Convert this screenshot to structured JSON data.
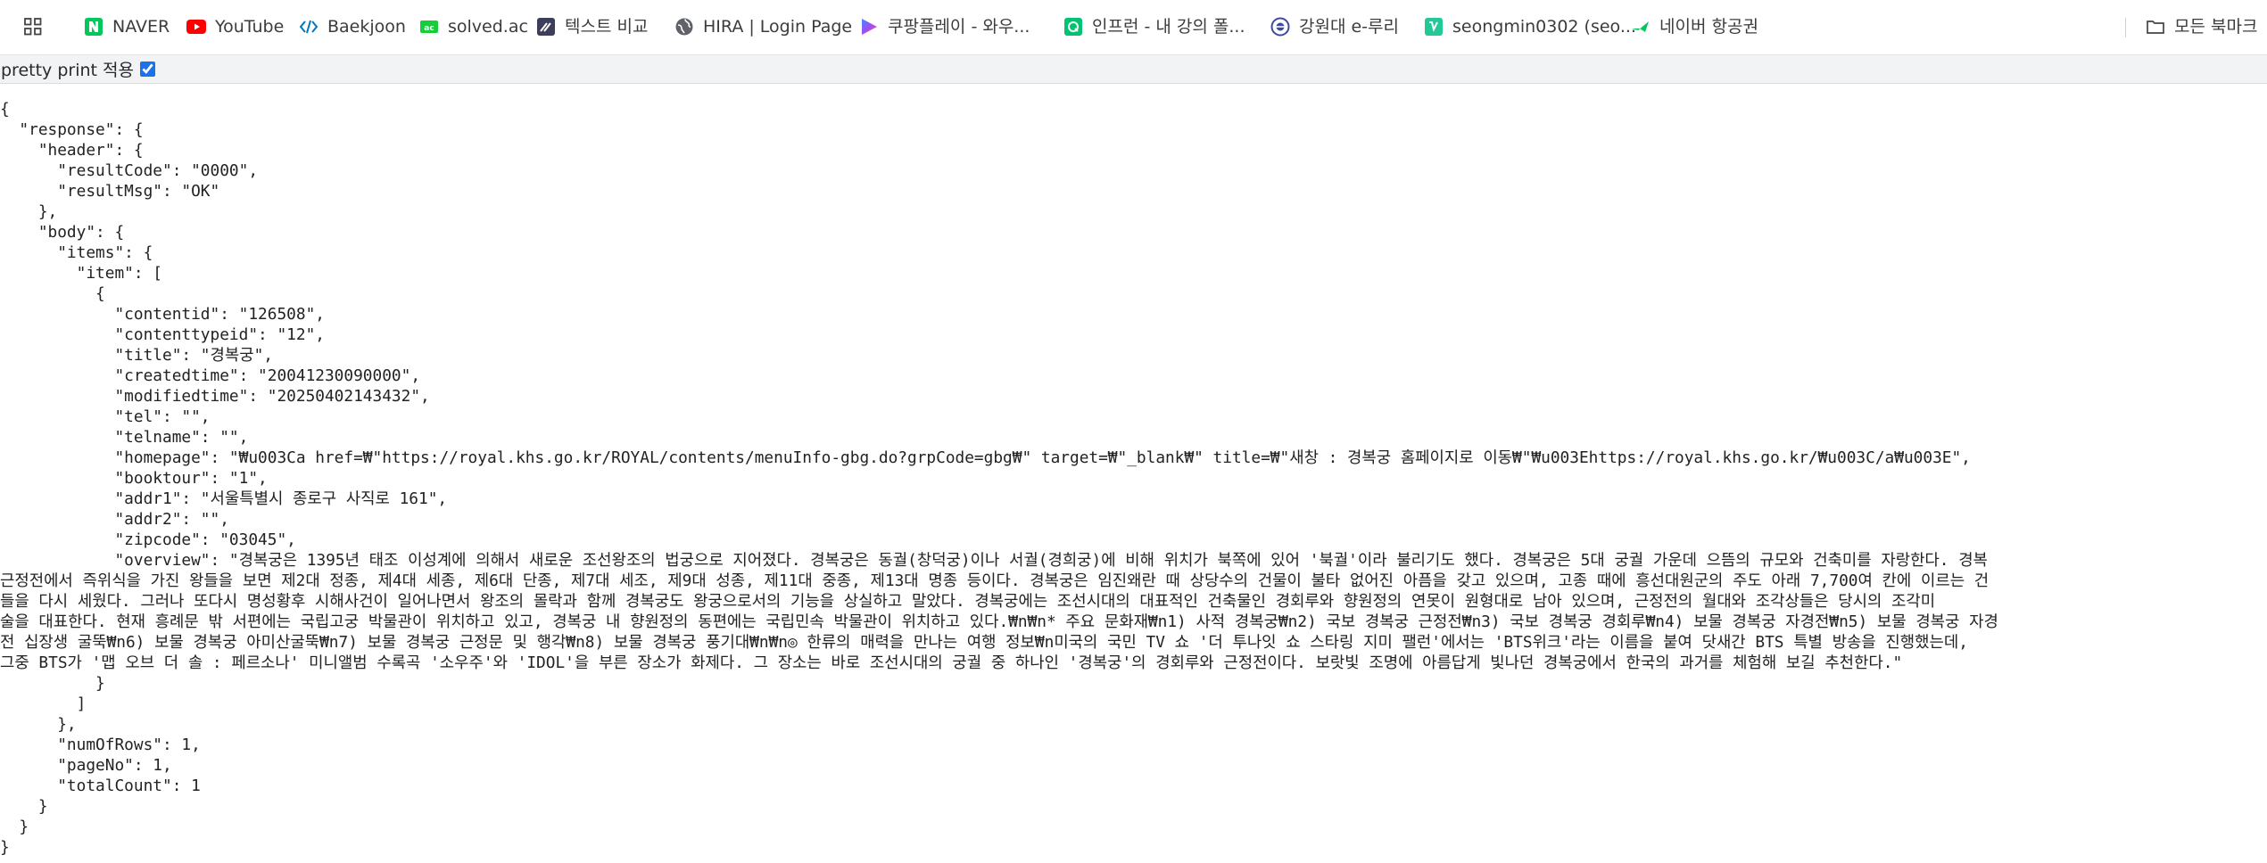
{
  "bookmarks": [
    {
      "label": "",
      "icon": "apps-grid-icon"
    },
    {
      "label": "NAVER",
      "icon": "naver-icon",
      "color": "#03c75a"
    },
    {
      "label": "YouTube",
      "icon": "youtube-icon",
      "color": "#ff0000"
    },
    {
      "label": "Baekjoon",
      "icon": "baekjoon-icon",
      "color": "#0076c0"
    },
    {
      "label": "solved.ac",
      "icon": "solvedac-icon",
      "color": "#17ce3a"
    },
    {
      "label": "텍스트 비교",
      "icon": "text-compare-icon",
      "color": "#3d3d5c"
    },
    {
      "label": "HIRA | Login Page",
      "icon": "globe-icon",
      "color": "#5f6368"
    },
    {
      "label": "쿠팡플레이 - 와우...",
      "icon": "play-icon",
      "color": "#7b5cf5"
    },
    {
      "label": "인프런 - 내 강의 폴...",
      "icon": "inflearn-icon",
      "color": "#00c471"
    },
    {
      "label": "강원대 e-루리",
      "icon": "kangwon-icon",
      "color": "#3b4ba5"
    },
    {
      "label": "seongmin0302 (seo...",
      "icon": "velog-icon",
      "color": "#20c997"
    },
    {
      "label": "네이버 항공권",
      "icon": "flight-icon",
      "color": "#03c75a"
    },
    {
      "label": "모든 북마크",
      "icon": "folder-icon",
      "color": "#5f6368"
    }
  ],
  "pretty_print": {
    "label": "pretty print 적용",
    "checked": true
  },
  "json_lines": [
    "{",
    "  \"response\": {",
    "    \"header\": {",
    "      \"resultCode\": \"0000\",",
    "      \"resultMsg\": \"OK\"",
    "    },",
    "    \"body\": {",
    "      \"items\": {",
    "        \"item\": [",
    "          {",
    "            \"contentid\": \"126508\",",
    "            \"contenttypeid\": \"12\",",
    "            \"title\": \"경복궁\",",
    "            \"createdtime\": \"20041230090000\",",
    "            \"modifiedtime\": \"20250402143432\",",
    "            \"tel\": \"\",",
    "            \"telname\": \"\",",
    "            \"homepage\": \"₩u003Ca href=₩\"https://royal.khs.go.kr/ROYAL/contents/menuInfo-gbg.do?grpCode=gbg₩\" target=₩\"_blank₩\" title=₩\"새창 : 경복궁 홈페이지로 이동₩\"₩u003Ehttps://royal.khs.go.kr/₩u003C/a₩u003E\",",
    "            \"booktour\": \"1\",",
    "            \"addr1\": \"서울특별시 종로구 사직로 161\",",
    "            \"addr2\": \"\",",
    "            \"zipcode\": \"03045\",",
    "            \"overview\": \"경복궁은 1395년 태조 이성계에 의해서 새로운 조선왕조의 법궁으로 지어졌다. 경복궁은 동궐(창덕궁)이나 서궐(경희궁)에 비해 위치가 북쪽에 있어 '북궐'이라 불리기도 했다. 경복궁은 5대 궁궐 가운데 으뜸의 규모와 건축미를 자랑한다. 경복",
    "근정전에서 즉위식을 가진 왕들을 보면 제2대 정종, 제4대 세종, 제6대 단종, 제7대 세조, 제9대 성종, 제11대 중종, 제13대 명종 등이다. 경복궁은 임진왜란 때 상당수의 건물이 불타 없어진 아픔을 갖고 있으며, 고종 때에 흥선대원군의 주도 아래 7,700여 칸에 이르는 건",
    "들을 다시 세웠다. 그러나 또다시 명성황후 시해사건이 일어나면서 왕조의 몰락과 함께 경복궁도 왕궁으로서의 기능을 상실하고 말았다. 경복궁에는 조선시대의 대표적인 건축물인 경회루와 향원정의 연못이 원형대로 남아 있으며, 근정전의 월대와 조각상들은 당시의 조각미",
    "술을 대표한다. 현재 흥례문 밖 서편에는 국립고궁 박물관이 위치하고 있고, 경복궁 내 향원정의 동편에는 국립민속 박물관이 위치하고 있다.₩n₩n* 주요 문화재₩n1) 사적 경복궁₩n2) 국보 경복궁 근정전₩n3) 국보 경복궁 경회루₩n4) 보물 경복궁 자경전₩n5) 보물 경복궁 자경",
    "전 십장생 굴뚝₩n6) 보물 경복궁 아미산굴뚝₩n7) 보물 경복궁 근정문 및 행각₩n8) 보물 경복궁 풍기대₩n₩n◎ 한류의 매력을 만나는 여행 정보₩n미국의 국민 TV 쇼 '더 투나잇 쇼 스타링 지미 팰런'에서는 'BTS위크'라는 이름을 붙여 닷새간 BTS 특별 방송을 진행했는데,",
    "그중 BTS가 '맵 오브 더 솔 : 페르소나' 미니앨범 수록곡 '소우주'와 'IDOL'을 부른 장소가 화제다. 그 장소는 바로 조선시대의 궁궐 중 하나인 '경복궁'의 경회루와 근정전이다. 보랏빛 조명에 아름답게 빛나던 경복궁에서 한국의 과거를 체험해 보길 추천한다.\"",
    "          }",
    "        ]",
    "      },",
    "      \"numOfRows\": 1,",
    "      \"pageNo\": 1,",
    "      \"totalCount\": 1",
    "    }",
    "  }",
    "}"
  ]
}
